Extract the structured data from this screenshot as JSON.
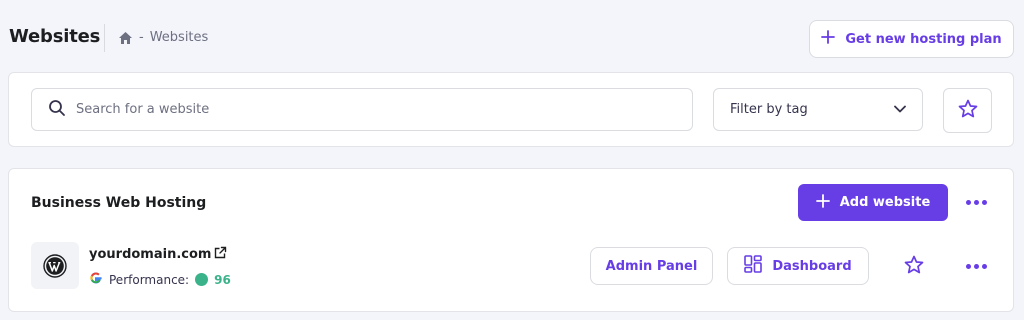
{
  "header": {
    "title": "Websites",
    "breadcrumb_separator": "-",
    "breadcrumb_current": "Websites",
    "get_plan_label": "Get new hosting plan"
  },
  "filters": {
    "search_placeholder": "Search for a website",
    "search_value": "",
    "tag_filter_label": "Filter by tag"
  },
  "hosting": {
    "title": "Business Web Hosting",
    "add_website_label": "Add website",
    "sites": [
      {
        "domain": "yourdomain.com",
        "performance_label": "Performance:",
        "performance_score": "96",
        "admin_label": "Admin Panel",
        "dashboard_label": "Dashboard"
      }
    ]
  },
  "icons": {
    "breadcrumb": "home-icon",
    "get_plan": "plus-icon",
    "search": "search-icon",
    "filter": "chevron-down-icon",
    "favorites": "star-icon",
    "add_website": "plus-icon",
    "more": "more-dots-icon",
    "site_logo": "wordpress-icon",
    "external": "external-link-icon",
    "performance_source": "google-icon",
    "dashboard": "dashboard-icon"
  },
  "colors": {
    "accent": "#673de6",
    "background": "#f4f4fb",
    "performance_good": "#3bb38a",
    "text_dark": "#1d1e20",
    "text_muted": "#6d7081"
  }
}
